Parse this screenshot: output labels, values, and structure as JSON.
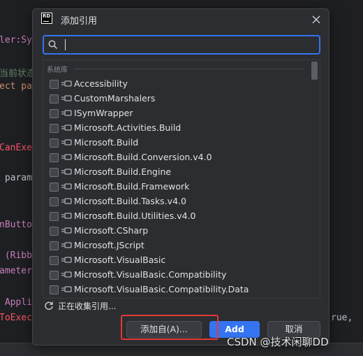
{
  "background_code": [
    {
      "text": "ler:Sy",
      "color": "#c77dbb"
    },
    {
      "text": "当前状态",
      "color": "#5f826b"
    },
    {
      "text": "ect pa",
      "color": "#cf8e6d"
    },
    {
      "text": "CanExe",
      "color": "#f75464"
    },
    {
      "text": " param",
      "color": "#bcbec4"
    },
    {
      "text": "nButto",
      "color": "#c77dbb"
    },
    {
      "text": " (Ribb",
      "color": "#c77dbb"
    },
    {
      "text": "ameter",
      "color": "#c77dbb"
    },
    {
      "text": " Appli",
      "color": "#c77dbb"
    },
    {
      "text": "ToExec",
      "color": "#f75464"
    },
    {
      "text": "rue,",
      "color": "#bcbec4"
    }
  ],
  "dialog": {
    "app_logo_text": "RD",
    "title": "添加引用",
    "search": {
      "value": "",
      "placeholder": ""
    },
    "group_header": "系统库",
    "references": [
      "Accessibility",
      "CustomMarshalers",
      "ISymWrapper",
      "Microsoft.Activities.Build",
      "Microsoft.Build",
      "Microsoft.Build.Conversion.v4.0",
      "Microsoft.Build.Engine",
      "Microsoft.Build.Framework",
      "Microsoft.Build.Tasks.v4.0",
      "Microsoft.Build.Utilities.v4.0",
      "Microsoft.CSharp",
      "Microsoft.JScript",
      "Microsoft.VisualBasic",
      "Microsoft.VisualBasic.Compatibility",
      "Microsoft.VisualBasic.Compatibility.Data"
    ],
    "status_text": "正在收集引用...",
    "buttons": {
      "add_from": "添加自(A)...",
      "add": "Add",
      "cancel": "取消"
    }
  },
  "watermark": "CSDN @技术闲聊DD",
  "colors": {
    "accent": "#3574f0",
    "highlight": "#e53935",
    "dialog_bg": "#2b2d30"
  }
}
